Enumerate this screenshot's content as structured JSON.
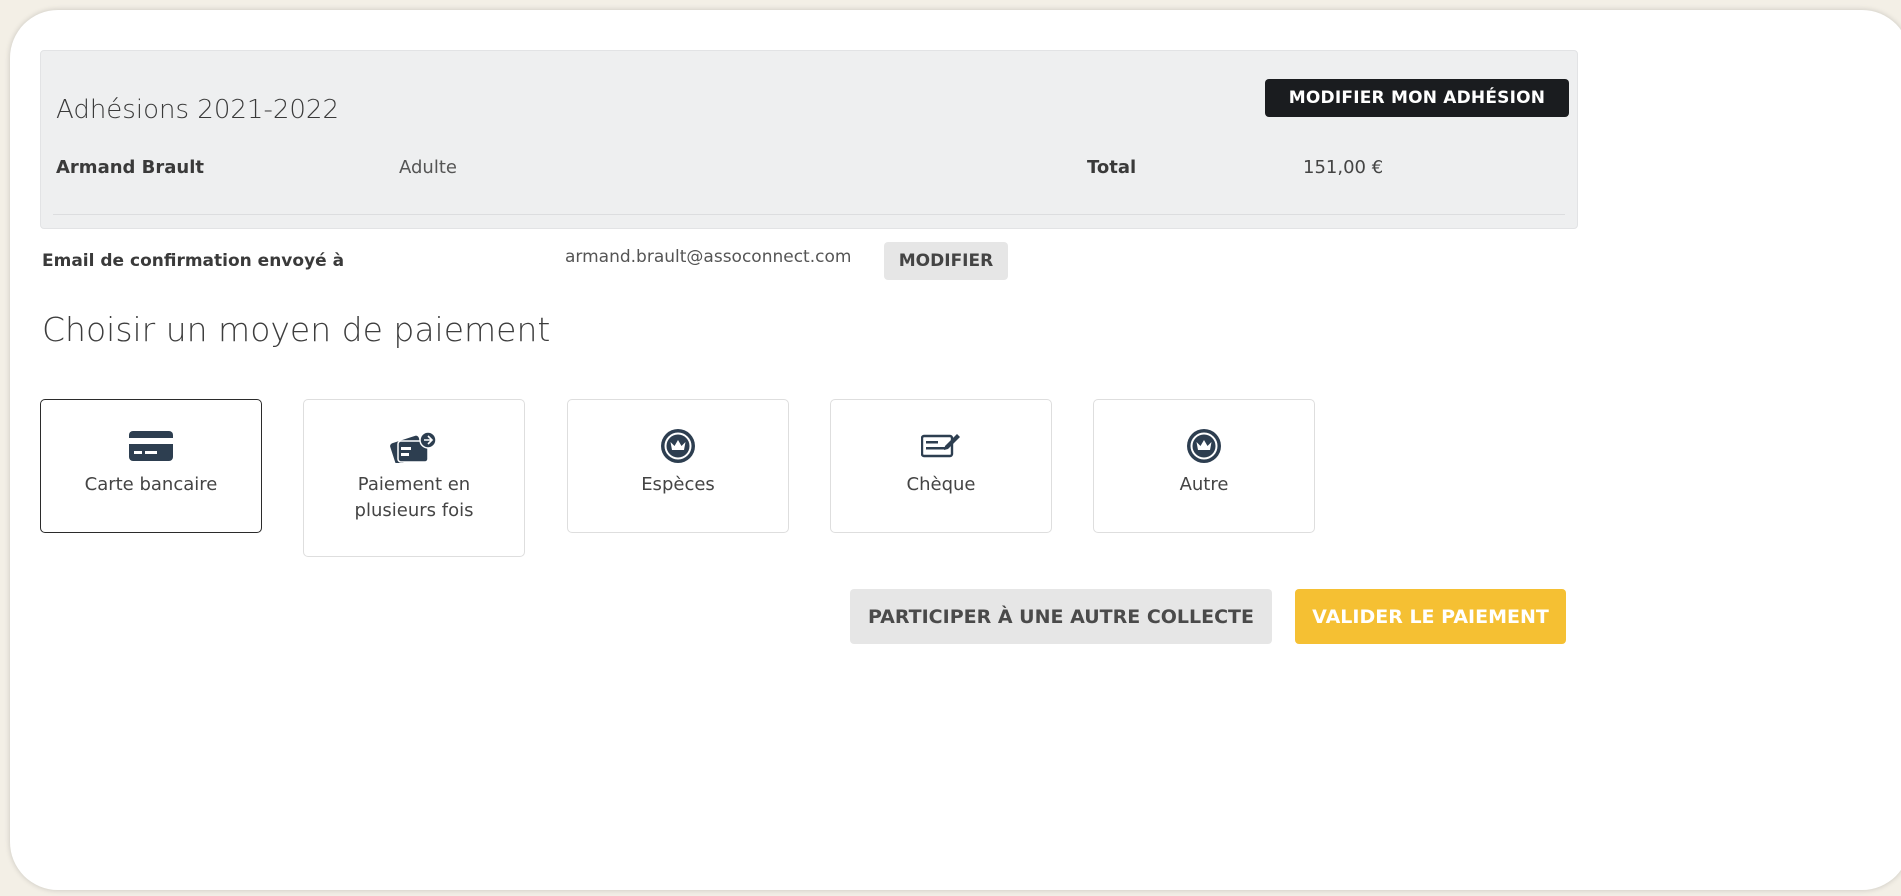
{
  "summary": {
    "title": "Adhésions 2021-2022",
    "modify_button": "MODIFIER MON ADHÉSION",
    "member_name": "Armand Brault",
    "member_type": "Adulte",
    "total_label": "Total",
    "total_value": "151,00 €"
  },
  "email": {
    "label": "Email de confirmation envoyé à",
    "value": "armand.brault@assoconnect.com",
    "modify_button": "MODIFIER"
  },
  "payment": {
    "title": "Choisir un moyen de paiement",
    "methods": [
      {
        "label": "Carte bancaire",
        "icon": "credit-card-icon",
        "selected": true
      },
      {
        "label": "Paiement en plusieurs fois",
        "icon": "multiple-cards-icon",
        "selected": false
      },
      {
        "label": "Espèces",
        "icon": "crown-icon",
        "selected": false
      },
      {
        "label": "Chèque",
        "icon": "cheque-icon",
        "selected": false
      },
      {
        "label": "Autre",
        "icon": "crown-icon",
        "selected": false
      }
    ]
  },
  "actions": {
    "other_collect": "PARTICIPER À UNE AUTRE COLLECTE",
    "validate": "VALIDER LE PAIEMENT"
  },
  "colors": {
    "accent": "#f5c033",
    "dark": "#1a1c1f",
    "summary_bg": "#eeeff0",
    "page_bg": "#f3efe6"
  }
}
